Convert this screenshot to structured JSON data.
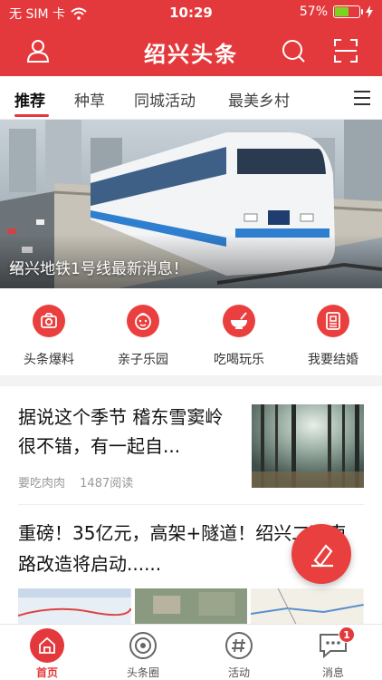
{
  "status_bar": {
    "carrier": "无 SIM 卡",
    "time": "10:29",
    "battery_percent": "57%",
    "battery_level": 0.57
  },
  "header": {
    "title": "绍兴头条"
  },
  "tabs": [
    {
      "label": "推荐",
      "active": true
    },
    {
      "label": "种草"
    },
    {
      "label": "同城活动"
    },
    {
      "label": "最美乡村"
    }
  ],
  "banner": {
    "caption": "绍兴地铁1号线最新消息！"
  },
  "quick_links": [
    {
      "label": "头条爆料",
      "icon": "camera-icon"
    },
    {
      "label": "亲子乐园",
      "icon": "child-face-icon"
    },
    {
      "label": "吃喝玩乐",
      "icon": "bowl-icon"
    },
    {
      "label": "我要结婚",
      "icon": "document-icon"
    }
  ],
  "articles": [
    {
      "title": "据说这个季节 稽东雪窦岭很不错，有一起自...",
      "author": "要吃肉肉",
      "reads": "1487阅读"
    },
    {
      "title": "重磅！35亿元，高架+隧道！绍兴二环南路改造将启动......"
    }
  ],
  "bottom_nav": [
    {
      "label": "首页",
      "icon": "home-icon",
      "active": true
    },
    {
      "label": "头条圈",
      "icon": "target-icon"
    },
    {
      "label": "活动",
      "icon": "hash-icon"
    },
    {
      "label": "消息",
      "icon": "chat-icon",
      "badge": "1"
    }
  ],
  "colors": {
    "brand_red": "#e4393c",
    "battery_green": "#7ed321"
  }
}
